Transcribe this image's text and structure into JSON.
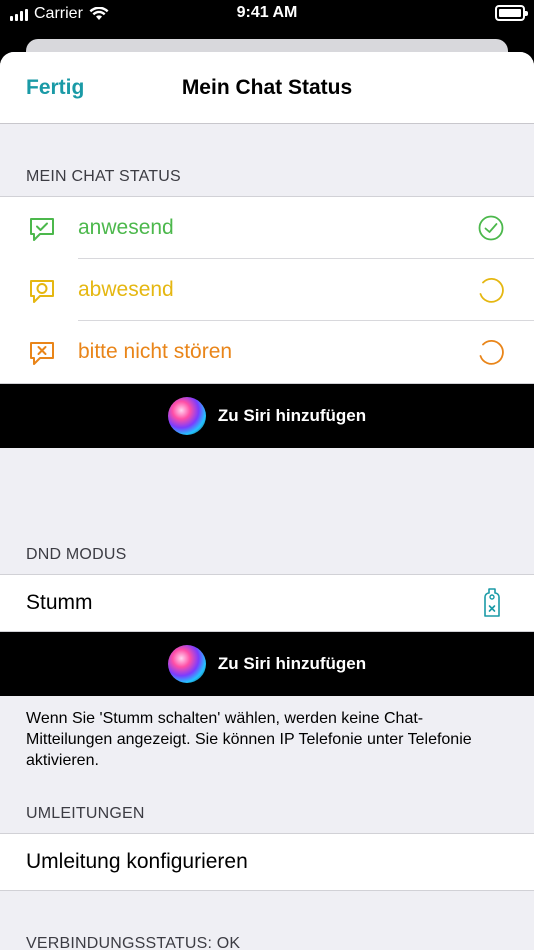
{
  "status_bar": {
    "carrier": "Carrier",
    "time": "9:41 AM",
    "icons": [
      "signal-icon",
      "wifi-icon",
      "battery-icon"
    ]
  },
  "nav": {
    "done_label": "Fertig",
    "title": "Mein Chat Status"
  },
  "chat_status": {
    "header": "MEIN CHAT STATUS",
    "items": [
      {
        "label": "anwesend",
        "color": "#4cb84c",
        "icon": "chat-bubble-check-icon",
        "indicator": "checkmark-circle-icon"
      },
      {
        "label": "abwesend",
        "color": "#e5b711",
        "icon": "chat-bubble-away-icon",
        "indicator": "partial-circle-icon"
      },
      {
        "label": "bitte nicht stören",
        "color": "#e98519",
        "icon": "chat-bubble-x-icon",
        "indicator": "partial-circle-icon"
      }
    ],
    "siri_label": "Zu Siri hinzufügen"
  },
  "dnd": {
    "header": "DND MODUS",
    "row_label": "Stumm",
    "row_icon": "door-hanger-icon",
    "siri_label": "Zu Siri hinzufügen",
    "footer": "Wenn Sie 'Stumm schalten' wählen, werden keine Chat-Mitteilungen angezeigt. Sie können IP Telefonie unter Telefonie aktivieren."
  },
  "forwarding": {
    "header": "UMLEITUNGEN",
    "row_label": "Umleitung konfigurieren"
  },
  "connection": {
    "header": "VERBINDUNGSSTATUS: OK"
  },
  "colors": {
    "accent": "#1a9aa6",
    "present": "#4cb84c",
    "away": "#e5b711",
    "dnd": "#e98519",
    "background": "#efeff4"
  }
}
